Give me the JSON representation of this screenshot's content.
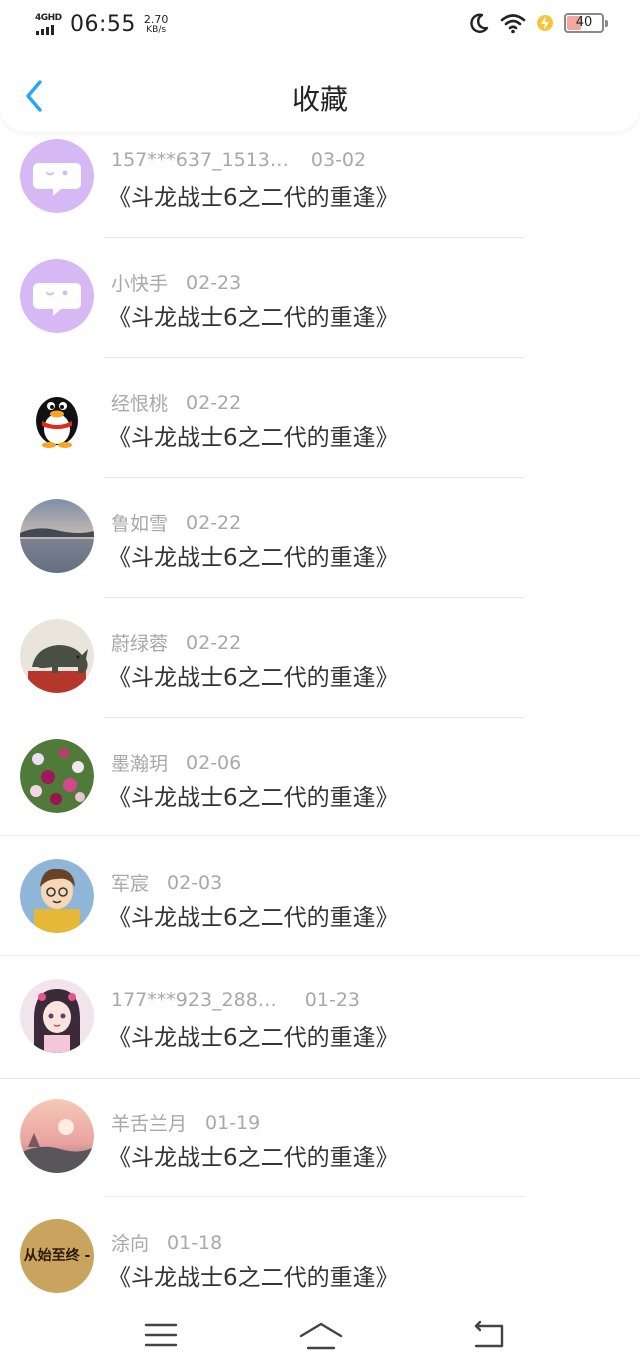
{
  "status_bar": {
    "network": "4GHD",
    "time": "06:55",
    "speed_value": "2.70",
    "speed_unit": "KB/s",
    "battery_level": "40",
    "battery_fraction": 0.4,
    "icons": [
      "signal-icon",
      "moon-icon",
      "wifi-icon",
      "charging-bolt-icon",
      "battery-icon"
    ]
  },
  "header": {
    "title": "收藏",
    "back_icon": "chevron-left-icon",
    "accent_color": "#2aa4f4"
  },
  "items": [
    {
      "name": "157***637_1513…",
      "date": "03-02",
      "title": "《斗龙战士6之二代的重逢》",
      "avatar": "default-purple-chat-avatar"
    },
    {
      "name": "小快手",
      "date": "02-23",
      "title": "《斗龙战士6之二代的重逢》",
      "avatar": "default-purple-chat-avatar"
    },
    {
      "name": "经恨桃",
      "date": "02-22",
      "title": "《斗龙战士6之二代的重逢》",
      "avatar": "qq-penguin-avatar"
    },
    {
      "name": "鲁如雪",
      "date": "02-22",
      "title": "《斗龙战士6之二代的重逢》",
      "avatar": "lake-landscape-avatar"
    },
    {
      "name": "蔚绿蓉",
      "date": "02-22",
      "title": "《斗龙战士6之二代的重逢》",
      "avatar": "bronze-rhino-avatar"
    },
    {
      "name": "墨瀚玥",
      "date": "02-06",
      "title": "《斗龙战士6之二代的重逢》",
      "avatar": "flowers-avatar"
    },
    {
      "name": "军宸",
      "date": "02-03",
      "title": "《斗龙战士6之二代的重逢》",
      "avatar": "cartoon-boy-avatar"
    },
    {
      "name": "177***923_288…",
      "date": "01-23",
      "title": "《斗龙战士6之二代的重逢》",
      "avatar": "anime-girl-avatar"
    },
    {
      "name": "羊舌兰月",
      "date": "01-19",
      "title": "《斗龙战士6之二代的重逢》",
      "avatar": "pink-sunset-avatar"
    },
    {
      "name": "涂向",
      "date": "01-18",
      "title": "《斗龙战士6之二代的重逢》",
      "avatar": "text-badge-avatar",
      "avatar_text": "从始至终 -"
    }
  ],
  "bottom_nav": {
    "icons": [
      "menu-icon",
      "home-icon",
      "back-icon"
    ]
  }
}
